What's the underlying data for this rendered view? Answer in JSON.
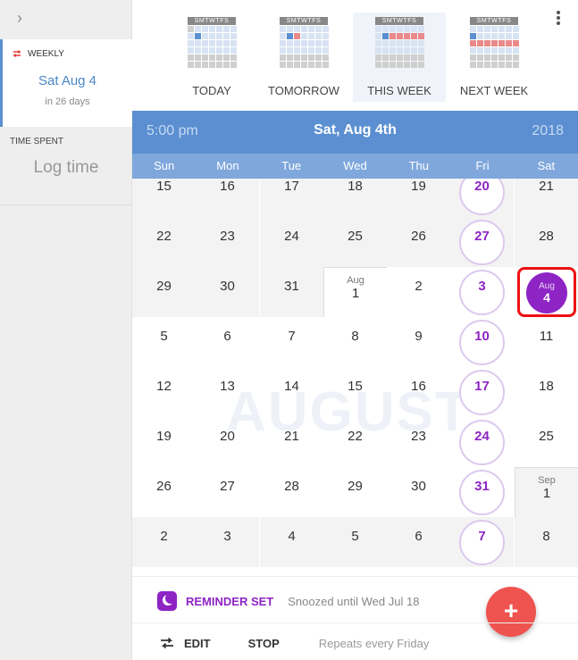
{
  "sidebar": {
    "weekly": {
      "label": "WEEKLY",
      "date": "Sat Aug 4",
      "sub": "in 26 days"
    },
    "time_spent": {
      "label": "TIME SPENT",
      "log_time": "Log time"
    }
  },
  "quick_select": {
    "header_letters": "SMTWTFS",
    "items": [
      {
        "label": "TODAY"
      },
      {
        "label": "TOMORROW"
      },
      {
        "label": "THIS WEEK"
      },
      {
        "label": "NEXT WEEK"
      }
    ]
  },
  "header": {
    "time": "5:00 pm",
    "date": "Sat, Aug 4th",
    "year": "2018"
  },
  "weekdays": [
    "Sun",
    "Mon",
    "Tue",
    "Wed",
    "Thu",
    "Fri",
    "Sat"
  ],
  "watermark": "AUGUST",
  "weeks": [
    [
      "15",
      "16",
      "17",
      "18",
      "19",
      "20",
      "21"
    ],
    [
      "22",
      "23",
      "24",
      "25",
      "26",
      "27",
      "28"
    ],
    [
      "29",
      "30",
      "31",
      "1",
      "2",
      "3",
      "4"
    ],
    [
      "5",
      "6",
      "7",
      "8",
      "9",
      "10",
      "11"
    ],
    [
      "12",
      "13",
      "14",
      "15",
      "16",
      "17",
      "18"
    ],
    [
      "19",
      "20",
      "21",
      "22",
      "23",
      "24",
      "25"
    ],
    [
      "26",
      "27",
      "28",
      "29",
      "30",
      "31",
      "1"
    ],
    [
      "2",
      "3",
      "4",
      "5",
      "6",
      "7",
      "8"
    ]
  ],
  "month_markers": {
    "aug": "Aug",
    "sep": "Sep"
  },
  "selected": {
    "month": "Aug",
    "day": "4"
  },
  "reminder": {
    "label": "REMINDER SET",
    "sub": "Snoozed until Wed Jul 18"
  },
  "actions": {
    "edit": "EDIT",
    "stop": "STOP",
    "repeat_text": "Repeats every Friday"
  },
  "fab": {
    "label": "+"
  },
  "colors": {
    "accent_blue": "#5b8fd1",
    "purple": "#8e24c4",
    "fab_red": "#ef5350",
    "highlight_red": "#ee1111"
  }
}
